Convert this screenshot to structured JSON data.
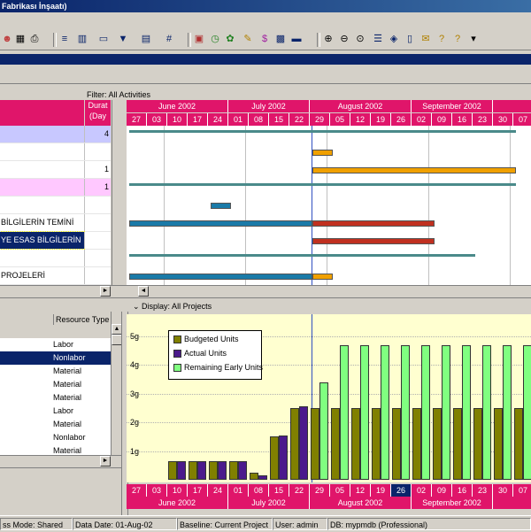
{
  "window": {
    "title": "Fabrikası İnşaatı)"
  },
  "upper": {
    "filter": "Filter: All Activities",
    "duration_header": "Durat (Day",
    "activities": [
      {
        "name": "",
        "duration": "4",
        "bg": "#c8c8ff"
      },
      {
        "name": "",
        "duration": "",
        "bg": "#ffffff"
      },
      {
        "name": "",
        "duration": "1",
        "bg": "#ffffff"
      },
      {
        "name": "",
        "duration": "1",
        "bg": "#ffc8ff"
      },
      {
        "name": "",
        "duration": "",
        "bg": "#ffffff"
      },
      {
        "name": "BİLGİLERİN TEMİNİ",
        "duration": "",
        "bg": "#ffffff"
      },
      {
        "name": "YE ESAS BİLGİLERİN",
        "duration": "",
        "bg": "#0a246a"
      },
      {
        "name": "",
        "duration": "",
        "bg": "#ffffff"
      },
      {
        "name": "PROJELERİ",
        "duration": "",
        "bg": "#ffffff"
      }
    ]
  },
  "timescale": {
    "months": [
      "June 2002",
      "July 2002",
      "August 2002",
      "September 2002",
      ""
    ],
    "days": [
      "27",
      "03",
      "10",
      "17",
      "24",
      "01",
      "08",
      "15",
      "22",
      "29",
      "05",
      "12",
      "19",
      "26",
      "02",
      "09",
      "16",
      "23",
      "30",
      "07"
    ],
    "lower_days": [
      "27",
      "03",
      "10",
      "17",
      "24",
      "01",
      "08",
      "15",
      "22",
      "29",
      "05",
      "12",
      "19",
      "26",
      "02",
      "09",
      "16",
      "23",
      "30",
      "07"
    ],
    "lower_highlight_day": "26"
  },
  "lower": {
    "display": "Display: All Projects",
    "resource_type_header": "Resource Type",
    "resource_types": [
      "Labor",
      "Nonlabor",
      "Material",
      "Material",
      "Material",
      "Labor",
      "Material",
      "Nonlabor",
      "Material"
    ],
    "selected_index": 1
  },
  "chart_data": {
    "type": "bar",
    "ylabels": [
      "5g",
      "4g",
      "3g",
      "2g",
      "1g"
    ],
    "ylim": [
      0,
      5.5
    ],
    "legend": [
      "Budgeted Units",
      "Actual Units",
      "Remaining Early Units"
    ],
    "colors": {
      "budgeted": "#808000",
      "actual": "#4b1a8c",
      "remaining": "#80ff80"
    },
    "weeks": [
      {
        "label": "27",
        "budgeted": 0,
        "actual": 0,
        "remaining": 0
      },
      {
        "label": "03",
        "budgeted": 0,
        "actual": 0,
        "remaining": 0
      },
      {
        "label": "10",
        "budgeted": 0.65,
        "actual": 0.65,
        "remaining": 0
      },
      {
        "label": "17",
        "budgeted": 0.65,
        "actual": 0.65,
        "remaining": 0
      },
      {
        "label": "24",
        "budgeted": 0.65,
        "actual": 0.65,
        "remaining": 0
      },
      {
        "label": "01",
        "budgeted": 0.65,
        "actual": 0.65,
        "remaining": 0
      },
      {
        "label": "08",
        "budgeted": 0.25,
        "actual": 0.15,
        "remaining": 0
      },
      {
        "label": "15",
        "budgeted": 1.5,
        "actual": 1.55,
        "remaining": 0
      },
      {
        "label": "22",
        "budgeted": 2.5,
        "actual": 2.55,
        "remaining": 0
      },
      {
        "label": "29",
        "budgeted": 2.5,
        "actual": 1.5,
        "remaining": 3.4
      },
      {
        "label": "05",
        "budgeted": 2.5,
        "actual": 0,
        "remaining": 4.7
      },
      {
        "label": "12",
        "budgeted": 2.5,
        "actual": 0,
        "remaining": 4.7
      },
      {
        "label": "19",
        "budgeted": 2.5,
        "actual": 0,
        "remaining": 4.7
      },
      {
        "label": "26",
        "budgeted": 2.5,
        "actual": 0,
        "remaining": 4.7
      },
      {
        "label": "02",
        "budgeted": 2.5,
        "actual": 0,
        "remaining": 4.7
      },
      {
        "label": "09",
        "budgeted": 2.5,
        "actual": 0,
        "remaining": 4.7
      },
      {
        "label": "16",
        "budgeted": 2.5,
        "actual": 0,
        "remaining": 4.7
      },
      {
        "label": "23",
        "budgeted": 2.5,
        "actual": 0,
        "remaining": 4.7
      },
      {
        "label": "30",
        "budgeted": 2.5,
        "actual": 0,
        "remaining": 4.7
      },
      {
        "label": "07",
        "budgeted": 2.5,
        "actual": 0,
        "remaining": 4.7
      }
    ]
  },
  "gantt_bars": [
    {
      "row": 0,
      "start": "27",
      "end": "07",
      "kind": "summary",
      "color": "#4a8a8a"
    },
    {
      "row": 1,
      "start": "29",
      "end": "05",
      "kind": "bar",
      "color": "#f0a000"
    },
    {
      "row": 2,
      "start": "29",
      "end": "07",
      "kind": "bar",
      "color": "#f0a000"
    },
    {
      "row": 3,
      "start": "27",
      "end": "07",
      "kind": "summary",
      "color": "#4a8a8a"
    },
    {
      "row": 4,
      "start": "24",
      "end": "01",
      "kind": "bar",
      "color": "#1a7aa8"
    },
    {
      "row": 5,
      "start": "27",
      "end": "29",
      "kind": "bar",
      "color": "#1a7aa8"
    },
    {
      "row": 5,
      "start": "29",
      "end": "09",
      "kind": "bar",
      "color": "#c03020"
    },
    {
      "row": 6,
      "start": "29",
      "end": "09",
      "kind": "bar",
      "color": "#c03020"
    },
    {
      "row": 7,
      "start": "27",
      "end": "23",
      "kind": "summary",
      "color": "#4a8a8a"
    },
    {
      "row": 8,
      "start": "27",
      "end": "29",
      "kind": "bar",
      "color": "#1a7aa8"
    },
    {
      "row": 8,
      "start": "29",
      "end": "05",
      "kind": "bar",
      "color": "#f0a000"
    }
  ],
  "status": {
    "access": "ss Mode: Shared",
    "data_date": "Data Date: 01-Aug-02",
    "baseline": "Baseline: Current Project",
    "user": "User: admin",
    "db": "DB: mypmdb (Professional)"
  }
}
